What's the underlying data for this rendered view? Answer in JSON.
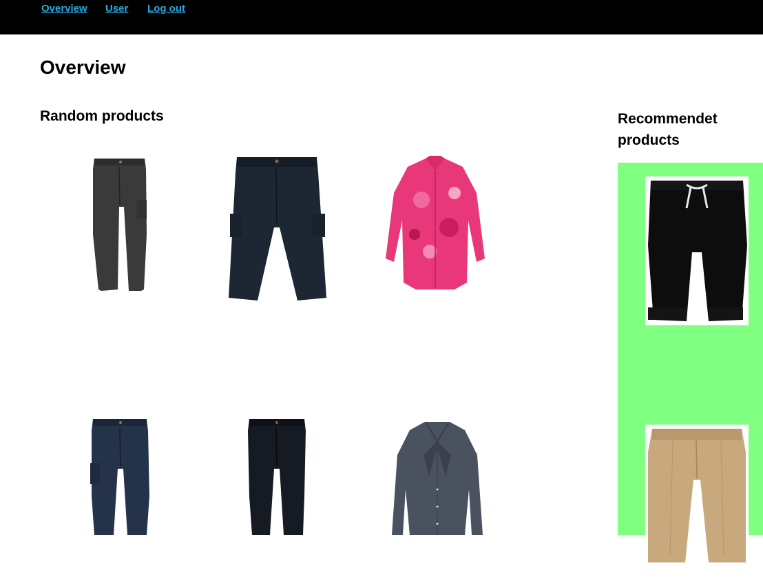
{
  "nav": {
    "overview": "Overview",
    "user": "User",
    "logout": "Log out"
  },
  "page": {
    "title": "Overview"
  },
  "random_products": {
    "title": "Random products",
    "items": [
      {
        "icon": "dark-grey-cargo-trousers-image"
      },
      {
        "icon": "navy-cargo-shorts-image"
      },
      {
        "icon": "pink-paisley-shirt-image"
      },
      {
        "icon": "navy-cargo-trousers-image"
      },
      {
        "icon": "black-chino-trousers-image"
      },
      {
        "icon": "grey-bow-blouse-image"
      }
    ]
  },
  "recommended_products": {
    "title": "Recommendet products",
    "items": [
      {
        "icon": "black-drawstring-shorts-image"
      },
      {
        "icon": "beige-chino-shorts-image"
      }
    ]
  },
  "colors": {
    "nav_bg": "#000000",
    "nav_link": "#29a8e0",
    "recommend_panel": "#80ff80"
  }
}
